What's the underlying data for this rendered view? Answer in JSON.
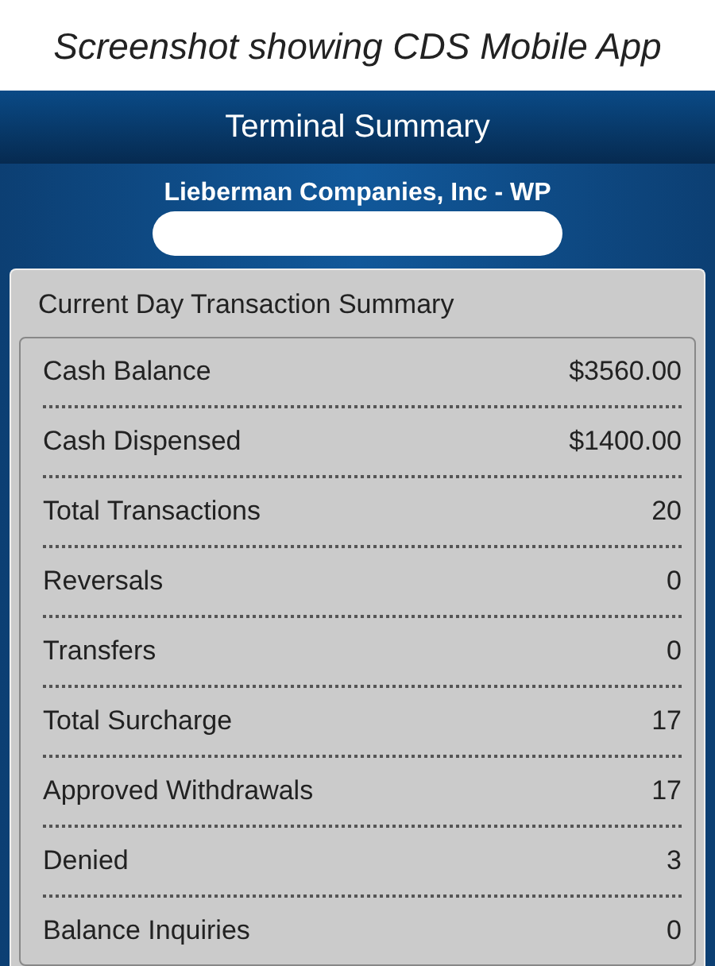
{
  "caption": "Screenshot showing CDS Mobile App",
  "header": {
    "title": "Terminal Summary"
  },
  "company": "Lieberman Companies, Inc - WP",
  "summary": {
    "title": "Current Day Transaction Summary",
    "rows": [
      {
        "label": "Cash Balance",
        "value": "$3560.00"
      },
      {
        "label": "Cash Dispensed",
        "value": "$1400.00"
      },
      {
        "label": "Total Transactions",
        "value": "20"
      },
      {
        "label": "Reversals",
        "value": "0"
      },
      {
        "label": "Transfers",
        "value": "0"
      },
      {
        "label": "Total Surcharge",
        "value": "17"
      },
      {
        "label": "Approved Withdrawals",
        "value": "17"
      },
      {
        "label": "Denied",
        "value": "3"
      },
      {
        "label": "Balance Inquiries",
        "value": "0"
      }
    ]
  }
}
